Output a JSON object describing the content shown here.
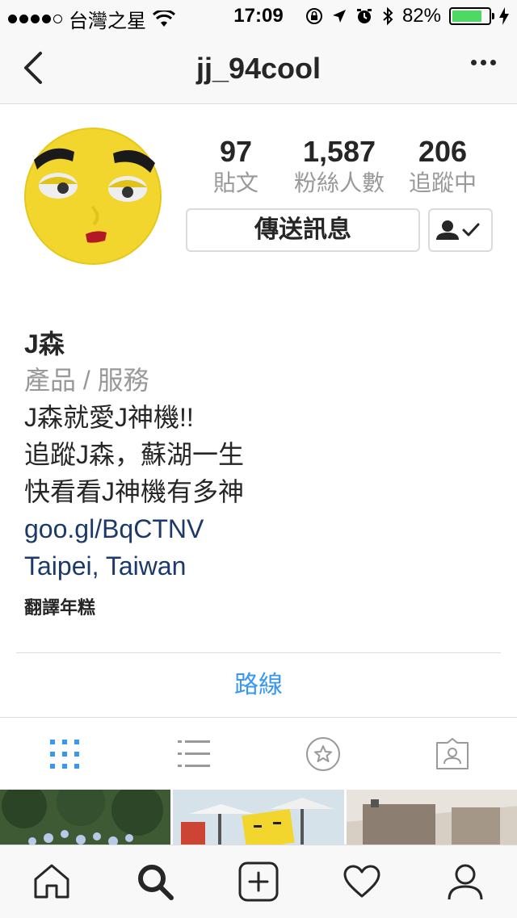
{
  "status_bar": {
    "carrier": "台灣之星",
    "time": "17:09",
    "battery": "82%",
    "battery_level": 0.82,
    "signal_icon": "signal-dots-icon",
    "icons": [
      "wifi-icon",
      "orientation-lock-icon",
      "location-icon",
      "alarm-icon",
      "bluetooth-icon",
      "battery-icon",
      "charging-icon"
    ]
  },
  "nav": {
    "title": "jj_94cool",
    "back_icon": "chevron-left-icon",
    "more_icon": "more-dots-icon"
  },
  "profile": {
    "posts_count": "97",
    "posts_label": "貼文",
    "followers_count": "1,587",
    "followers_label": "粉絲人數",
    "following_count": "206",
    "following_label": "追蹤中",
    "message_button": "傳送訊息",
    "following_icon": "person-check-icon"
  },
  "bio": {
    "name": "J森",
    "category": "產品 / 服務",
    "lines": [
      "J森就愛J神機!!",
      "追蹤J森，蘇湖一生",
      "快看看J神機有多神"
    ],
    "website": "goo.gl/BqCTNV",
    "location": "Taipei, Taiwan",
    "translate": "翻譯年糕"
  },
  "directions_label": "路線",
  "tabs": [
    "grid-icon",
    "list-icon",
    "star-icon",
    "tagged-icon"
  ],
  "bottom_bar": [
    "home-icon",
    "search-icon",
    "add-icon",
    "heart-icon",
    "profile-icon"
  ],
  "colors": {
    "accent": "#3897f0",
    "link": "#1b3a6b",
    "muted": "#999999",
    "border": "#dbdbdb",
    "battery": "#4cd964"
  }
}
